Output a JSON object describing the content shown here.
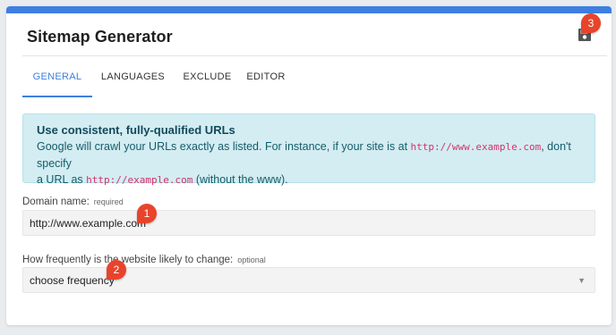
{
  "header": {
    "title": "Sitemap Generator",
    "accent_color": "#3d7fe0",
    "save_icon": "save-icon"
  },
  "tabs": [
    {
      "label": "GENERAL",
      "active": true
    },
    {
      "label": "LANGUAGES",
      "active": false
    },
    {
      "label": "EXCLUDE",
      "active": false
    },
    {
      "label": "EDITOR",
      "active": false
    }
  ],
  "alert": {
    "title": "Use consistent, fully-qualified URLs",
    "line1_text": "Google will crawl your URLs exactly as listed. For instance, if your site is at ",
    "line1_code": "http://www.example.com",
    "line1_tail": ", don't specify",
    "line2_text": "a URL as ",
    "line2_code": "http://example.com",
    "line2_tail": " (without the www)."
  },
  "domain": {
    "label": "Domain name:",
    "hint": "required",
    "value": "http://www.example.com"
  },
  "frequency": {
    "label": "How frequently is the website likely to change:",
    "hint": "optional",
    "selected": "choose frequency"
  },
  "markers": [
    "1",
    "2",
    "3"
  ]
}
